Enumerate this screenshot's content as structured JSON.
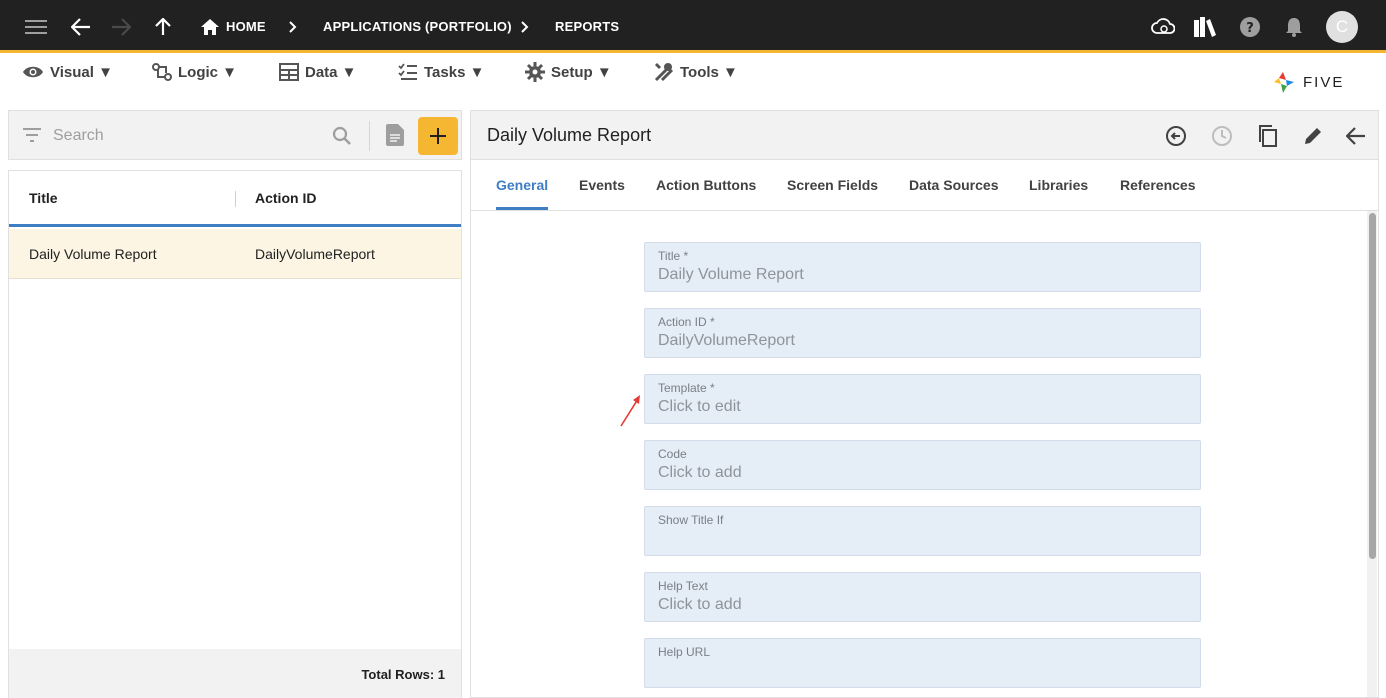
{
  "breadcrumb": {
    "home": "HOME",
    "applications": "APPLICATIONS (PORTFOLIO)",
    "reports": "REPORTS"
  },
  "user": {
    "avatar_initial": "C"
  },
  "menu": {
    "visual": "Visual ▼",
    "logic": "Logic ▼",
    "data": "Data ▼",
    "tasks": "Tasks ▼",
    "setup": "Setup ▼",
    "tools": "Tools ▼"
  },
  "brand": {
    "logo_text": "FIVE"
  },
  "list": {
    "search_placeholder": "Search",
    "columns": [
      "Title",
      "Action ID"
    ],
    "rows": [
      {
        "title": "Daily Volume Report",
        "action_id": "DailyVolumeReport"
      }
    ],
    "footer": "Total Rows: 1"
  },
  "detail": {
    "title": "Daily Volume Report",
    "tabs": [
      "General",
      "Events",
      "Action Buttons",
      "Screen Fields",
      "Data Sources",
      "Libraries",
      "References"
    ],
    "active_tab": "General",
    "fields": [
      {
        "label": "Title *",
        "value": "Daily Volume Report"
      },
      {
        "label": "Action ID *",
        "value": "DailyVolumeReport"
      },
      {
        "label": "Template *",
        "value": "Click to edit"
      },
      {
        "label": "Code",
        "value": "Click to add"
      },
      {
        "label": "Show Title If",
        "value": ""
      },
      {
        "label": "Help Text",
        "value": "Click to add"
      },
      {
        "label": "Help URL",
        "value": ""
      }
    ]
  },
  "colors": {
    "topbar": "#212121",
    "accent": "#f5b731",
    "primary": "#3f7ec2",
    "field_bg": "#e5edf6",
    "selected_row": "#fdf5e4",
    "annotation_arrow": "#e53935"
  },
  "icons": {
    "topbar_left": [
      "menu-icon",
      "back-arrow-icon",
      "forward-arrow-icon",
      "up-arrow-icon",
      "home-icon"
    ],
    "topbar_right": [
      "cloud-icon",
      "library-icon",
      "help-icon",
      "bell-icon"
    ],
    "detail_actions": [
      "restore-icon",
      "history-icon",
      "copy-icon",
      "edit-icon",
      "close-back-icon"
    ]
  }
}
